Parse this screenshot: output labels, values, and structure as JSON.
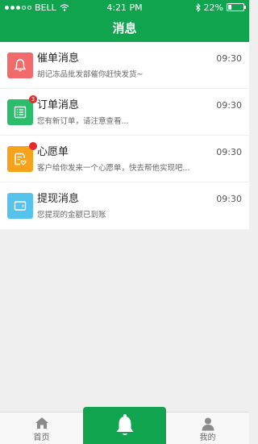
{
  "status_bar": {
    "carrier": "BELL",
    "time": "4:21 PM",
    "battery": "22%",
    "battery_level": 0.22
  },
  "header": {
    "title": "消息"
  },
  "messages": [
    {
      "title": "催单消息",
      "subtitle": "胡记冻品批发部催你赶快发货~",
      "time": "09:30",
      "icon": "bell-icon",
      "color": "#f26b6b",
      "badge": ""
    },
    {
      "title": "订单消息",
      "subtitle": "您有新订单，请注意查看...",
      "time": "09:30",
      "icon": "order-list-icon",
      "color": "#2bbd6b",
      "badge": "3"
    },
    {
      "title": "心愿单",
      "subtitle": "客户给你发来一个心愿单，快去帮他实现吧...",
      "time": "09:30",
      "icon": "wishlist-icon",
      "color": "#f7a21b",
      "badge": ""
    },
    {
      "title": "提现消息",
      "subtitle": "您提现的金额已到账",
      "time": "09:30",
      "icon": "wallet-icon",
      "color": "#56c2ee",
      "badge": ""
    }
  ],
  "tabbar": {
    "home_label": "首页",
    "mine_label": "我的"
  },
  "colors": {
    "brand": "#11a44e",
    "badge": "#e52b2b"
  }
}
